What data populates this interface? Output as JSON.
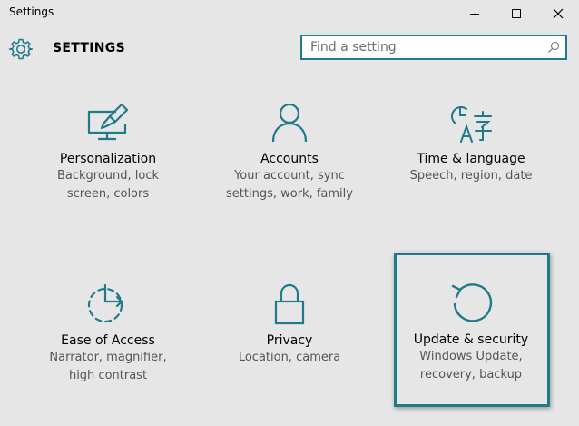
{
  "window": {
    "title": "Settings",
    "accent": "#1f7a8c"
  },
  "header": {
    "title": "SETTINGS",
    "search": {
      "placeholder": "Find a setting",
      "value": ""
    }
  },
  "tiles": [
    {
      "label": "Personalization",
      "desc_lines": [
        "Background, lock",
        "screen, colors"
      ],
      "icon": "personalization-icon"
    },
    {
      "label": "Accounts",
      "desc_lines": [
        "Your account, sync",
        "settings, work, family"
      ],
      "icon": "person-icon"
    },
    {
      "label": "Time & language",
      "desc_lines": [
        "Speech, region, date"
      ],
      "icon": "time-language-icon"
    },
    {
      "label": "Ease of Access",
      "desc_lines": [
        "Narrator, magnifier,",
        "high contrast"
      ],
      "icon": "ease-of-access-icon"
    },
    {
      "label": "Privacy",
      "desc_lines": [
        "Location, camera"
      ],
      "icon": "lock-icon"
    },
    {
      "label": "Update & security",
      "desc_lines": [
        "Windows Update,",
        "recovery, backup"
      ],
      "icon": "update-refresh-icon"
    }
  ]
}
